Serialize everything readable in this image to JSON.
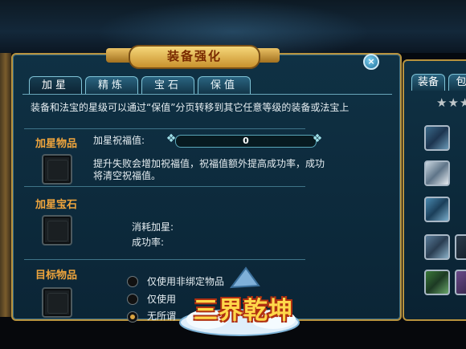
{
  "window": {
    "title": "装备强化",
    "close": "×"
  },
  "tabs": [
    "加星",
    "精炼",
    "宝石",
    "保值"
  ],
  "description": "装备和法宝的星级可以通过“保值”分页转移到其它任意等级的装备或法宝上",
  "star_section": {
    "label": "加星物品",
    "bless_label": "加星祝福值:",
    "bless_value": "0",
    "hint": "提升失败会增加祝福值，祝福值额外提高成功率，成功将清空祝福值。"
  },
  "gem_section": {
    "label": "加星宝石",
    "cost_label": "消耗加星:",
    "rate_label": "成功率:"
  },
  "target_section": {
    "label": "目标物品",
    "options": [
      {
        "label": "仅使用非绑定物品",
        "selected": false
      },
      {
        "label": "仅使用",
        "selected": false
      },
      {
        "label": "无所谓",
        "selected": true
      }
    ]
  },
  "side_panel": {
    "tabs": [
      "装备",
      "包"
    ],
    "stars": "★★★"
  },
  "logo": {
    "text": "三界乾坤"
  },
  "colors": {
    "frame_gold": "#b8933e",
    "panel_teal": "#0f3144",
    "section_orange": "#f0a53c"
  }
}
